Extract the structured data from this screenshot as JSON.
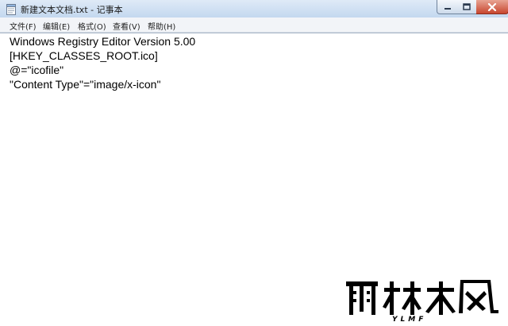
{
  "window": {
    "title": "新建文本文档.txt - 记事本"
  },
  "menu": [
    {
      "label": "文件(F)"
    },
    {
      "label": "编辑(E)"
    },
    {
      "label": "格式(O)"
    },
    {
      "label": "查看(V)"
    },
    {
      "label": "帮助(H)"
    }
  ],
  "editor": {
    "lines": [
      "Windows Registry Editor Version 5.00",
      "[HKEY_CLASSES_ROOT.ico]",
      "@=\"icofile\"",
      "\"Content Type\"=\"image/x-icon\""
    ]
  },
  "icons": {
    "app": "notepad-document-icon",
    "minimize": "minimize-icon",
    "maximize": "maximize-icon",
    "close": "close-icon"
  },
  "watermark": {
    "text": "雨林木风",
    "sub": "YLMF"
  },
  "colors": {
    "close_button": "#c7462f",
    "titlebar": "#c3d8ef",
    "editor_bg": "#ffffff"
  }
}
